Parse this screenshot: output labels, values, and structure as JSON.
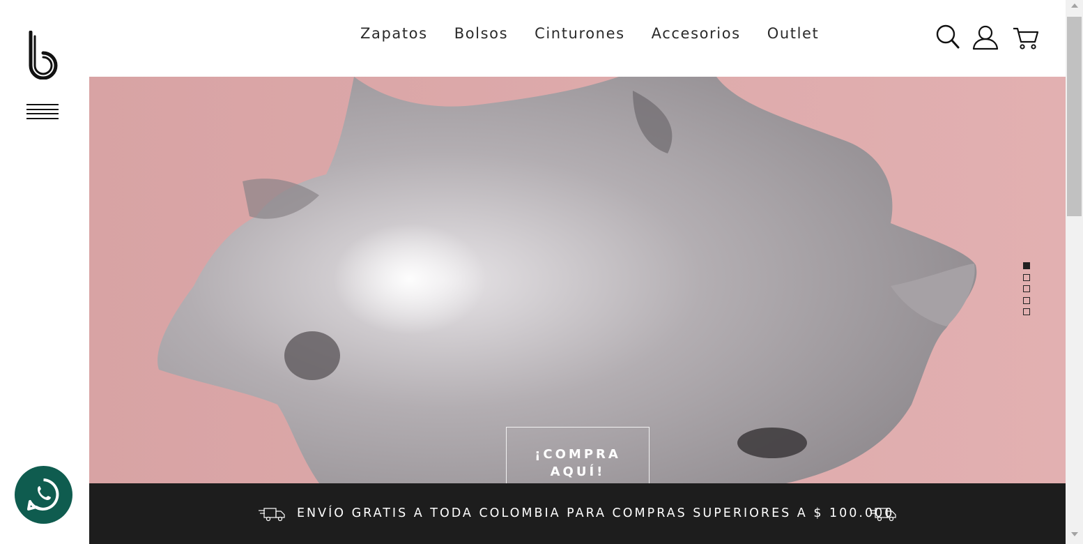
{
  "brand": {
    "logo_icon": "b-logo-icon"
  },
  "nav": {
    "items": [
      {
        "label": "Zapatos"
      },
      {
        "label": "Bolsos"
      },
      {
        "label": "Cinturones"
      },
      {
        "label": "Accesorios"
      },
      {
        "label": "Outlet"
      }
    ],
    "icons": [
      "search-icon",
      "user-icon",
      "cart-icon"
    ]
  },
  "hero": {
    "cta_line1": "¡COMPRA",
    "cta_line2": "AQUÍ!",
    "slides_total": 5,
    "active_slide": 1,
    "background_color": "#dca8a9"
  },
  "shipping": {
    "text": "ENVÍO GRATIS A TODA COLOMBIA PARA COMPRAS SUPERIORES A $ 100.000",
    "icon": "delivery-truck-icon"
  },
  "whatsapp": {
    "icon": "whatsapp-icon",
    "color": "#0f5c4f"
  }
}
